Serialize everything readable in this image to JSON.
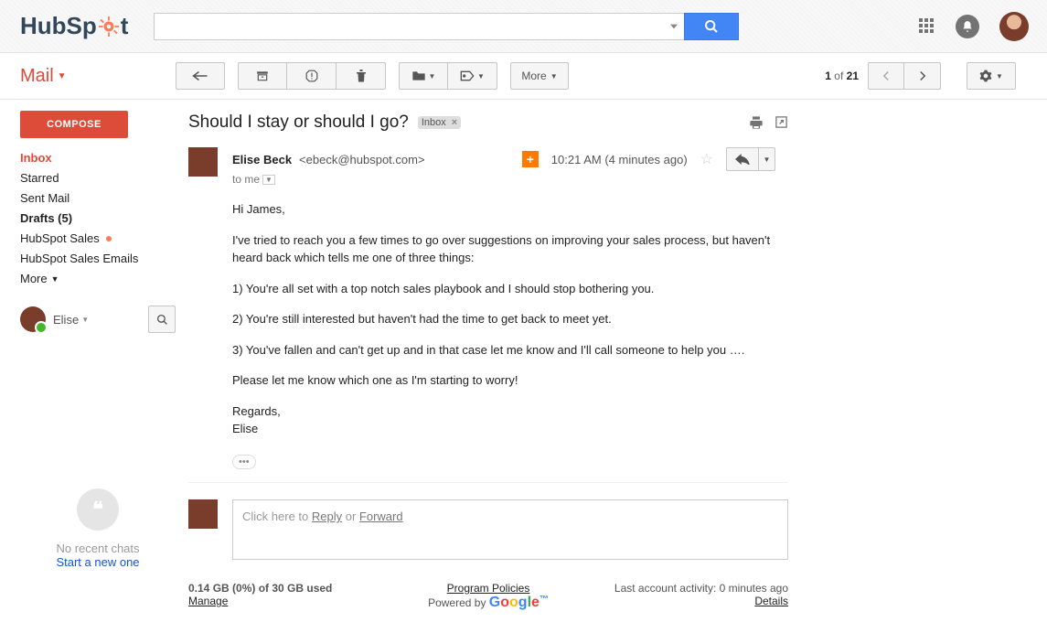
{
  "header": {
    "logo_text_left": "HubSp",
    "logo_text_right": "t",
    "search_placeholder": ""
  },
  "nav": {
    "mail_label": "Mail"
  },
  "pager": {
    "position": "1",
    "of_label": "of",
    "total": "21"
  },
  "toolbar": {
    "more_label": "More"
  },
  "sidebar": {
    "compose": "COMPOSE",
    "items": [
      "Inbox",
      "Starred",
      "Sent Mail",
      "Drafts (5)",
      "HubSpot Sales",
      "HubSpot Sales Emails"
    ],
    "more": "More",
    "chat_user": "Elise",
    "hangouts_empty": "No recent chats",
    "hangouts_start": "Start a new one"
  },
  "email": {
    "subject": "Should I stay or should I go?",
    "label_chip": "Inbox",
    "sender_name": "Elise Beck",
    "sender_email": "<ebeck@hubspot.com>",
    "to_line": "to me",
    "timestamp": "10:21 AM (4 minutes ago)",
    "body": {
      "greeting": "Hi James,",
      "p1": "I've tried to reach you a few times to go over suggestions on improving your sales process, but haven't heard back which tells me one of three things:",
      "p2": "1) You're all set with a top notch sales playbook and I should stop bothering you.",
      "p3": "2) You're still interested but haven't had the time to get back to meet yet.",
      "p4": "3) You've fallen and can't get up and in that case let me know and I'll call someone to help you ….",
      "p5": "Please let me know which one as I'm starting to worry!",
      "signoff1": "Regards,",
      "signoff2": "Elise"
    },
    "reply_prompt_pre": "Click here to ",
    "reply_link": "Reply",
    "reply_or": " or ",
    "forward_link": "Forward"
  },
  "footer": {
    "storage": "0.14 GB (0%) of 30 GB used",
    "manage": "Manage",
    "policies": "Program Policies",
    "powered": "Powered by ",
    "activity": "Last account activity: 0 minutes ago",
    "details": "Details"
  }
}
